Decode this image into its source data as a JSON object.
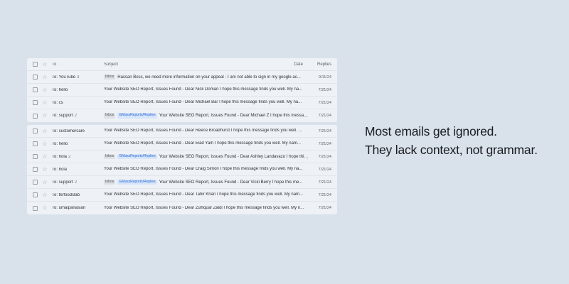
{
  "header": {
    "to": "To",
    "subject": "Subject",
    "date": "Date",
    "replies": "Replies"
  },
  "group1": [
    {
      "to": "To: YouTube",
      "count": "3",
      "badges": [
        "Inbox"
      ],
      "subject": "Hassan Boss, we need more information on your appeal - I am not able to sign in my google ac...",
      "date": "9/11/24"
    },
    {
      "to": "To: hello",
      "count": "",
      "badges": [],
      "subject": "Your Website SEO Report, Issues Found - Dear Nick Doman I hope this message finds you well. My na...",
      "date": "7/21/24"
    },
    {
      "to": "To: cs",
      "count": "",
      "badges": [],
      "subject": "Your Website SEO Report, Issues Found - Dear Michael Bar I hope this message finds you well. My na...",
      "date": "7/21/24"
    },
    {
      "to": "To: support",
      "count": "2",
      "badges": [
        "Inbox",
        "GMassReports/Replies"
      ],
      "subject": "Your Website SEO Report, Issues Found - Dear Michael Z I hope this message...",
      "date": "7/21/24"
    }
  ],
  "group2": [
    {
      "to": "To: customercare",
      "count": "",
      "badges": [],
      "subject": "Your Website SEO Report, Issues Found - Dear Reece Broadhurst I hope this message finds you well. ...",
      "date": "7/21/24"
    },
    {
      "to": "To: hello",
      "count": "",
      "badges": [],
      "subject": "Your Website SEO Report, Issues Found - Dear Elad Yam I hope this message finds you well. My nam...",
      "date": "7/21/24"
    },
    {
      "to": "To: hola",
      "count": "2",
      "badges": [
        "Inbox",
        "GMassReports/Replies"
      ],
      "subject": "Your Website SEO Report, Issues Found - Dear Ashley Landavazo I hope this ...",
      "date": "7/21/24"
    },
    {
      "to": "To: hola",
      "count": "",
      "badges": [],
      "subject": "Your Website SEO Report, Issues Found - Dear Craig Simon I hope this message finds you well. My na...",
      "date": "7/21/24"
    },
    {
      "to": "To: support",
      "count": "2",
      "badges": [
        "Inbox",
        "GMassReports/Replies"
      ],
      "subject": "Your Website SEO Report, Issues Found - Dear Vicki Berry I hope this me...",
      "date": "7/21/24"
    },
    {
      "to": "To: tkrfoodslab",
      "count": "",
      "badges": [],
      "subject": "Your Website SEO Report, Issues Found - Dear Tahir Khan I hope this message finds you well. My nam...",
      "date": "7/21/24"
    },
    {
      "to": "To: umaipanasian",
      "count": "",
      "badges": [],
      "subject": "Your Website SEO Report, Issues Found - Dear Zulfiquar Zaidi I hope this message finds you well. My n...",
      "date": "7/21/24"
    }
  ],
  "tagline": {
    "line1": "Most emails get ignored.",
    "line2": "They lack context, not grammar."
  },
  "colors": {
    "background": "#d9e1ea",
    "list_bg": "#eef1f6",
    "label_badge": "#d6e5fb",
    "label_text": "#2f6ad0"
  },
  "icons": [
    "checkbox-icon",
    "star-icon"
  ]
}
